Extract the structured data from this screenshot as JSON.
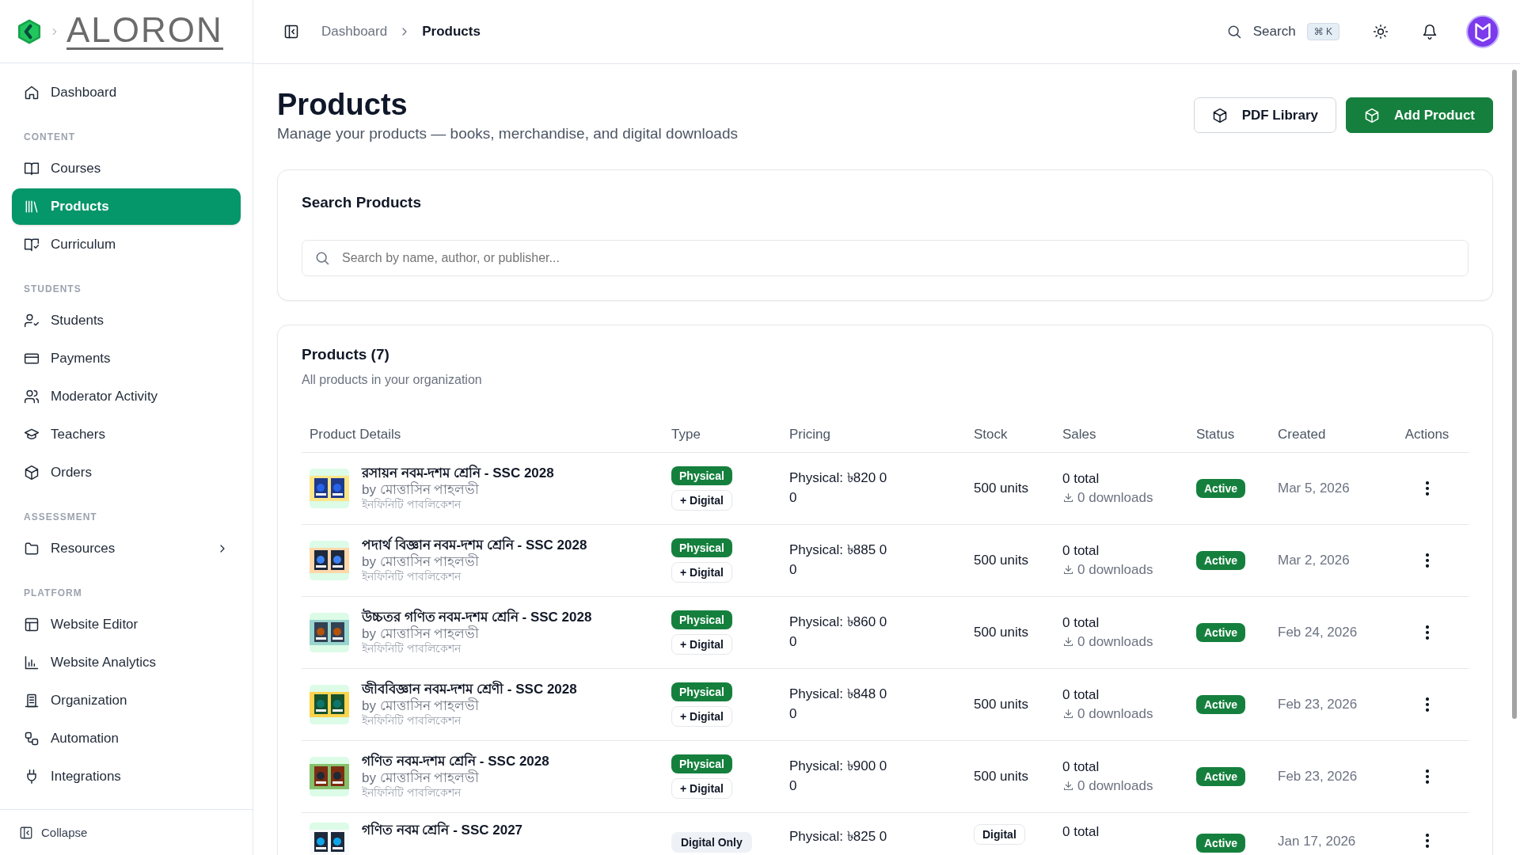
{
  "brand": {
    "name": "ALORON"
  },
  "sidebar": {
    "items": [
      {
        "kind": "link",
        "label": "Dashboard",
        "selected": false
      },
      {
        "kind": "heading",
        "label": "CONTENT"
      },
      {
        "kind": "link",
        "label": "Courses",
        "selected": false
      },
      {
        "kind": "link",
        "label": "Products",
        "selected": true
      },
      {
        "kind": "link",
        "label": "Curriculum",
        "selected": false
      },
      {
        "kind": "heading",
        "label": "STUDENTS"
      },
      {
        "kind": "link",
        "label": "Students",
        "selected": false
      },
      {
        "kind": "link",
        "label": "Payments",
        "selected": false
      },
      {
        "kind": "link",
        "label": "Moderator Activity",
        "selected": false
      },
      {
        "kind": "link",
        "label": "Teachers",
        "selected": false
      },
      {
        "kind": "link",
        "label": "Orders",
        "selected": false
      },
      {
        "kind": "heading",
        "label": "ASSESSMENT"
      },
      {
        "kind": "group",
        "label": "Resources",
        "selected": false,
        "expanded": false
      },
      {
        "kind": "heading",
        "label": "PLATFORM"
      },
      {
        "kind": "link",
        "label": "Website Editor",
        "selected": false
      },
      {
        "kind": "link",
        "label": "Website Analytics",
        "selected": false
      },
      {
        "kind": "link",
        "label": "Organization",
        "selected": false
      },
      {
        "kind": "link",
        "label": "Automation",
        "selected": false
      },
      {
        "kind": "link",
        "label": "Integrations",
        "selected": false
      }
    ],
    "collapse": "Collapse"
  },
  "breadcrumb": [
    "Dashboard",
    "Products"
  ],
  "topbar": {
    "search": "Search",
    "shortcut": "⌘ K"
  },
  "page": {
    "title": "Products",
    "subtitle": "Manage your products — books, merchandise, and digital downloads",
    "buttons": [
      {
        "label": "PDF Library",
        "kind": "secondary"
      },
      {
        "label": "Add Product",
        "kind": "primary"
      }
    ]
  },
  "search_card": {
    "title": "Search Products",
    "placeholder": "Search by name, author, or publisher..."
  },
  "table": {
    "title": "Products (7)",
    "subtitle": "All products in your organization",
    "columns": [
      "Product Details",
      "Type",
      "Pricing",
      "Stock",
      "Sales",
      "Status",
      "Created",
      "Actions"
    ],
    "rows": [
      {
        "title": "রসায়ন নবম-দশম শ্রেনি - SSC 2028",
        "author": "by মোত্তাসিন পাহলভী",
        "publisher": "ইনফিনিটি পাবলিকেশন",
        "types": [
          {
            "label": "Physical",
            "kind": "solid"
          },
          {
            "label": "+ Digital",
            "kind": "outline"
          }
        ],
        "pricing": [
          "Physical: ৳820 0",
          "0"
        ],
        "stock": {
          "kind": "text",
          "label": "500 units"
        },
        "sales": "0 total",
        "downloads": "0 downloads",
        "status": "Active",
        "created": "Mar 5, 2026"
      },
      {
        "title": "পদার্থ বিজ্ঞান নবম-দশম শ্রেনি - SSC 2028",
        "author": "by মোত্তাসিন পাহলভী",
        "publisher": "ইনফিনিটি পাবলিকেশন",
        "types": [
          {
            "label": "Physical",
            "kind": "solid"
          },
          {
            "label": "+ Digital",
            "kind": "outline"
          }
        ],
        "pricing": [
          "Physical: ৳885 0",
          "0"
        ],
        "stock": {
          "kind": "text",
          "label": "500 units"
        },
        "sales": "0 total",
        "downloads": "0 downloads",
        "status": "Active",
        "created": "Mar 2, 2026"
      },
      {
        "title": "উচ্চতর গণিত নবম-দশম শ্রেনি - SSC 2028",
        "author": "by মোত্তাসিন পাহলভী",
        "publisher": "ইনফিনিটি পাবলিকেশন",
        "types": [
          {
            "label": "Physical",
            "kind": "solid"
          },
          {
            "label": "+ Digital",
            "kind": "outline"
          }
        ],
        "pricing": [
          "Physical: ৳860 0",
          "0"
        ],
        "stock": {
          "kind": "text",
          "label": "500 units"
        },
        "sales": "0 total",
        "downloads": "0 downloads",
        "status": "Active",
        "created": "Feb 24, 2026"
      },
      {
        "title": "জীববিজ্ঞান নবম-দশম শ্রেণী - SSC 2028",
        "author": "by মোত্তাসিন পাহলভী",
        "publisher": "ইনফিনিটি পাবলিকেশন",
        "types": [
          {
            "label": "Physical",
            "kind": "solid"
          },
          {
            "label": "+ Digital",
            "kind": "outline"
          }
        ],
        "pricing": [
          "Physical: ৳848 0",
          "0"
        ],
        "stock": {
          "kind": "text",
          "label": "500 units"
        },
        "sales": "0 total",
        "downloads": "0 downloads",
        "status": "Active",
        "created": "Feb 23, 2026"
      },
      {
        "title": "গণিত নবম-দশম শ্রেনি - SSC 2028",
        "author": "by মোত্তাসিন পাহলভী",
        "publisher": "ইনফিনিটি পাবলিকেশন",
        "types": [
          {
            "label": "Physical",
            "kind": "solid"
          },
          {
            "label": "+ Digital",
            "kind": "outline"
          }
        ],
        "pricing": [
          "Physical: ৳900 0",
          "0"
        ],
        "stock": {
          "kind": "text",
          "label": "500 units"
        },
        "sales": "0 total",
        "downloads": "0 downloads",
        "status": "Active",
        "created": "Feb 23, 2026"
      },
      {
        "title": "গণিত নবম শ্রেনি - SSC 2027",
        "types": [
          {
            "label": "Digital Only",
            "kind": "muted"
          }
        ],
        "pricing": [
          "Physical: ৳825 0"
        ],
        "stock": {
          "kind": "badge",
          "label": "Digital"
        },
        "sales": "0 total",
        "status": "Active",
        "created": "Jan 17, 2026"
      }
    ]
  }
}
